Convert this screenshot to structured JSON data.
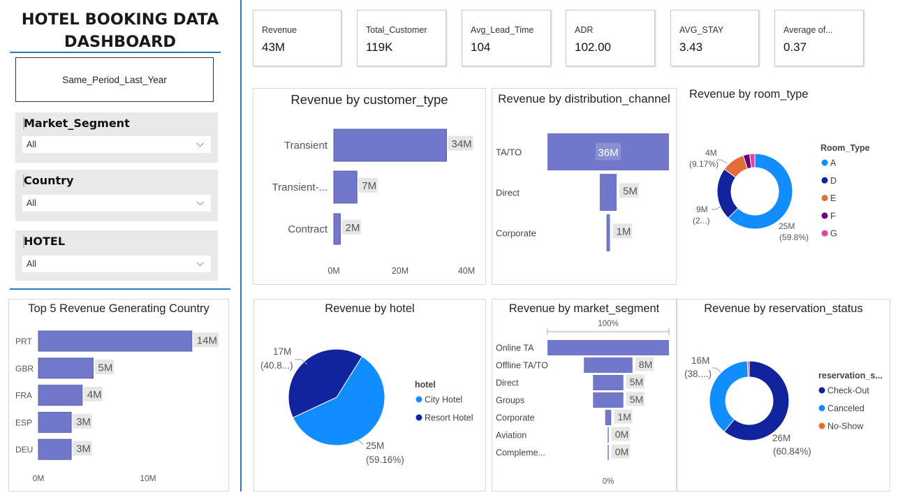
{
  "title_line1": "HOTEL BOOKING DATA",
  "title_line2": "DASHBOARD",
  "period_button": "Same_Period_Last_Year",
  "slicers": [
    {
      "title": "Market_Segment",
      "value": "All"
    },
    {
      "title": "Country",
      "value": "All"
    },
    {
      "title": "HOTEL",
      "value": "All"
    }
  ],
  "chevron": "⌵",
  "kpis": [
    {
      "label": "Revenue",
      "value": "43M"
    },
    {
      "label": "Total_Customer",
      "value": "119K"
    },
    {
      "label": "Avg_Lead_Time",
      "value": "104"
    },
    {
      "label": "ADR",
      "value": "102.00"
    },
    {
      "label": "AVG_STAY",
      "value": "3.43"
    },
    {
      "label": "Average of...",
      "value": "0.37"
    }
  ],
  "colors": {
    "bar": "#7177c9",
    "label_bg": "#e6e6e6",
    "accent_line": "#2b7bb9"
  },
  "chart_data": [
    {
      "id": "customer_type",
      "type": "bar",
      "orientation": "horizontal",
      "title": "Revenue by customer_type",
      "categories": [
        "Transient",
        "Transient-...",
        "Contract"
      ],
      "values": [
        34,
        7,
        2
      ],
      "data_labels": [
        "34M",
        "7M",
        "2M"
      ],
      "xlim": [
        0,
        40
      ],
      "x_ticks": [
        "0M",
        "20M",
        "40M"
      ],
      "unit": "M"
    },
    {
      "id": "distribution_channel",
      "type": "bar",
      "orientation": "funnel",
      "title": "Revenue by distribution_channel",
      "categories": [
        "TA/TO",
        "Direct",
        "Corporate"
      ],
      "values": [
        36,
        5,
        1
      ],
      "data_labels": [
        "36M",
        "5M",
        "1M"
      ],
      "unit": "M"
    },
    {
      "id": "room_type",
      "type": "pie",
      "variant": "donut",
      "title": "Revenue by room_type",
      "legend_title": "Room_Type",
      "categories": [
        "A",
        "D",
        "E",
        "F",
        "G"
      ],
      "values": [
        25,
        9,
        4,
        1.1,
        0.9
      ],
      "colors": [
        "#118dff",
        "#12239e",
        "#e66c37",
        "#6b007b",
        "#e044a7"
      ],
      "data_labels": [
        {
          "value": "25M",
          "pct": "(59.8%)"
        },
        {
          "value": "9M",
          "pct": "(2...)"
        },
        {
          "value": "4M",
          "pct": "(9.17%)"
        }
      ]
    },
    {
      "id": "top5_country",
      "type": "bar",
      "orientation": "horizontal",
      "title": "Top 5 Revenue Generating Country",
      "categories": [
        "PRT",
        "GBR",
        "FRA",
        "ESP",
        "DEU"
      ],
      "values": [
        14,
        5,
        4,
        3,
        3
      ],
      "data_labels": [
        "14M",
        "5M",
        "4M",
        "3M",
        "3M"
      ],
      "x_ticks": [
        "0M",
        "10M"
      ],
      "unit": "M"
    },
    {
      "id": "hotel",
      "type": "pie",
      "title": "Revenue by hotel",
      "legend_title": "hotel",
      "categories": [
        "City Hotel",
        "Resort Hotel"
      ],
      "values": [
        59.16,
        40.84
      ],
      "colors": [
        "#118dff",
        "#12239e"
      ],
      "data_labels": [
        {
          "value": "25M",
          "pct": "(59.16%)"
        },
        {
          "value": "17M",
          "pct": "(40.8...)"
        }
      ]
    },
    {
      "id": "market_segment",
      "type": "bar",
      "orientation": "funnel",
      "title": "Revenue by market_segment",
      "top_label": "100%",
      "bottom_label": "0%",
      "categories": [
        "Online TA",
        "Offline TA/TO",
        "Direct",
        "Groups",
        "Corporate",
        "Aviation",
        "Compleme..."
      ],
      "values": [
        20,
        8,
        5,
        5,
        1,
        0.05,
        0.02
      ],
      "data_labels": [
        "",
        "8M",
        "5M",
        "5M",
        "1M",
        "0M",
        "0M"
      ],
      "unit": "M"
    },
    {
      "id": "reservation_status",
      "type": "pie",
      "variant": "donut",
      "title": "Revenue by reservation_status",
      "legend_title": "reservation_s...",
      "categories": [
        "Check-Out",
        "Canceled",
        "No-Show"
      ],
      "values": [
        60.84,
        38.4,
        0.76
      ],
      "colors": [
        "#12239e",
        "#118dff",
        "#e66c37"
      ],
      "data_labels": [
        {
          "value": "26M",
          "pct": "(60.84%)"
        },
        {
          "value": "16M",
          "pct": "(38....)"
        }
      ]
    }
  ]
}
